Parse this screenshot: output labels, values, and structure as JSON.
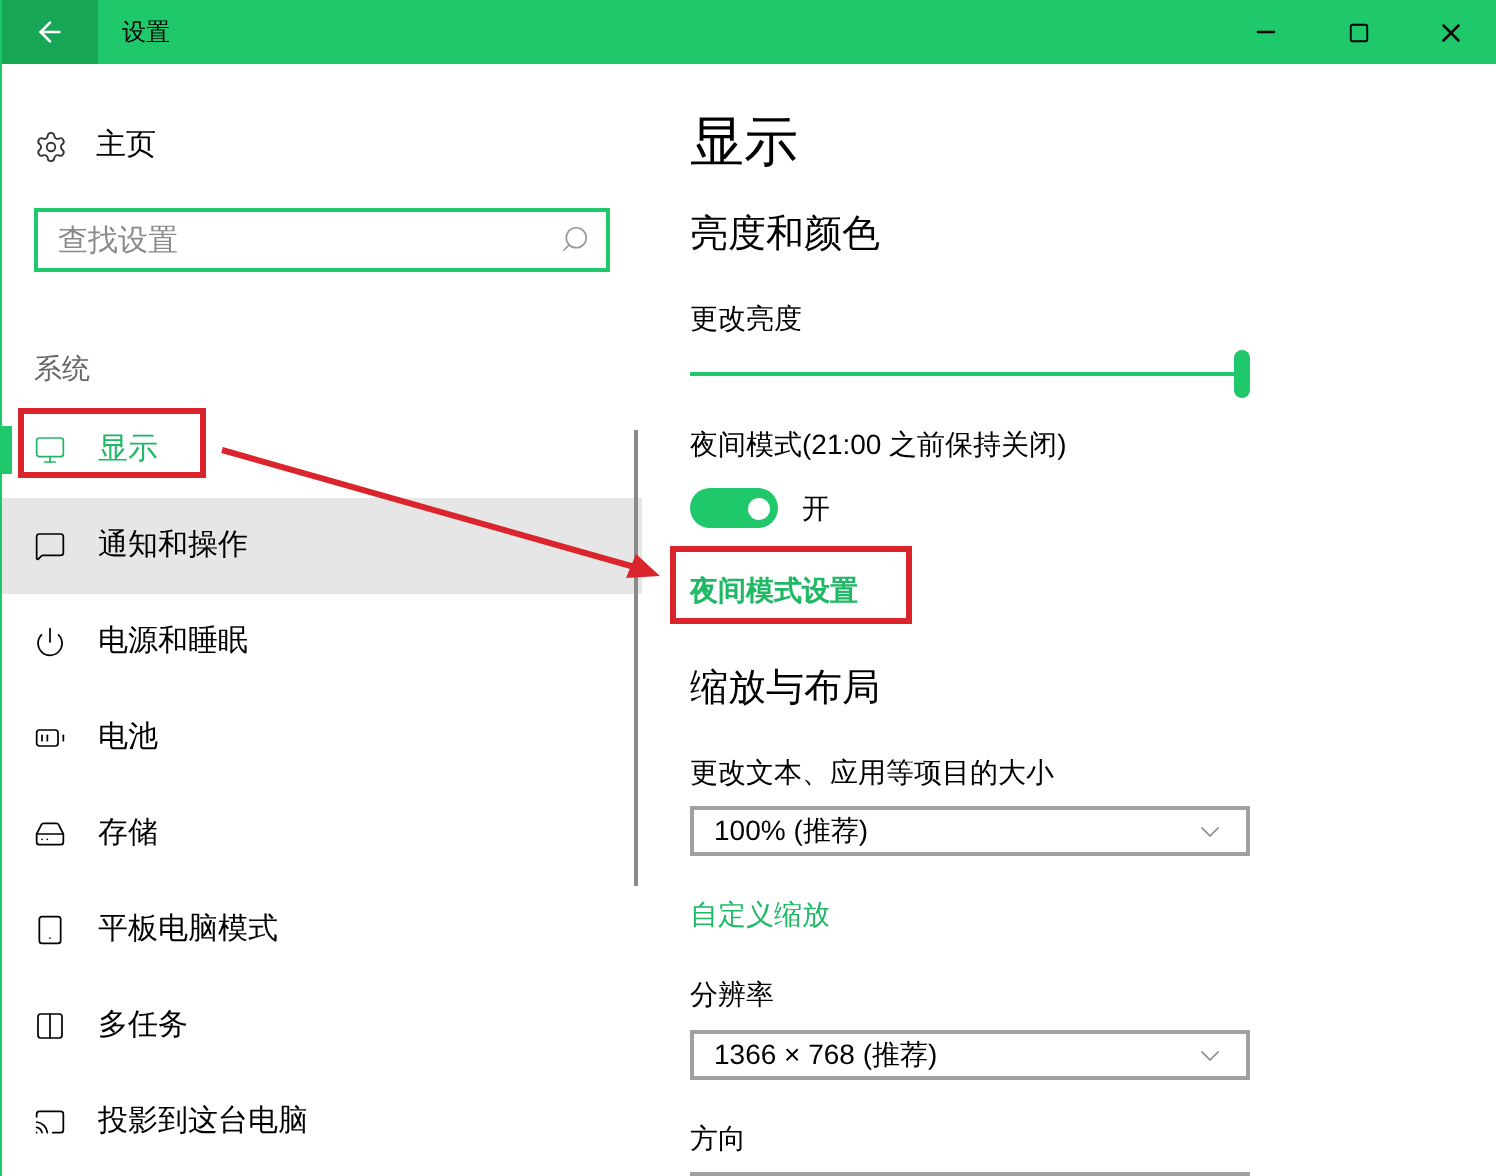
{
  "window": {
    "title": "设置"
  },
  "sidebar": {
    "home": "主页",
    "search": {
      "placeholder": "查找设置"
    },
    "section": "系统",
    "items": [
      {
        "label": "显示",
        "selected": true,
        "hovered": false
      },
      {
        "label": "通知和操作",
        "selected": false,
        "hovered": true
      },
      {
        "label": "电源和睡眠",
        "selected": false,
        "hovered": false
      },
      {
        "label": "电池",
        "selected": false,
        "hovered": false
      },
      {
        "label": "存储",
        "selected": false,
        "hovered": false
      },
      {
        "label": "平板电脑模式",
        "selected": false,
        "hovered": false
      },
      {
        "label": "多任务",
        "selected": false,
        "hovered": false
      },
      {
        "label": "投影到这台电脑",
        "selected": false,
        "hovered": false
      }
    ]
  },
  "content": {
    "title": "显示",
    "brightness_section": "亮度和颜色",
    "brightness_label": "更改亮度",
    "brightness": {
      "level": 1
    },
    "night_label": "夜间模式(21:00 之前保持关闭)",
    "night_toggle": {
      "on": true,
      "state_label": "开"
    },
    "night_link": "夜间模式设置",
    "scale_section": "缩放与布局",
    "scale_label": "更改文本、应用等项目的大小",
    "scale_value": "100% (推荐)",
    "custom_link": "自定义缩放",
    "resolution_label": "分辨率",
    "resolution_value": "1366 × 768 (推荐)",
    "orientation_label": "方向"
  }
}
